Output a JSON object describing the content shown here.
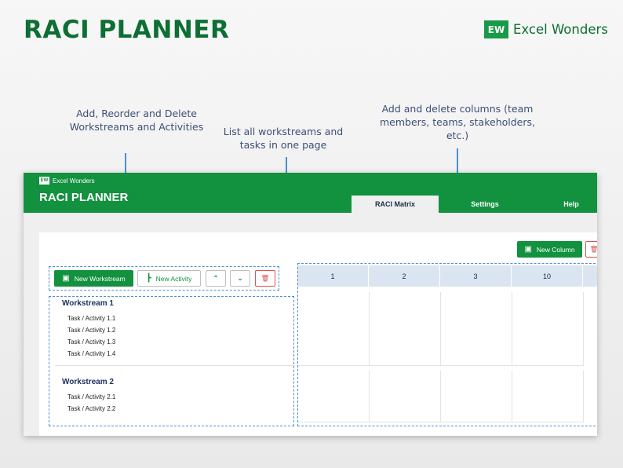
{
  "title": "RACI PLANNER",
  "brand": {
    "logo": "EW",
    "name": "Excel Wonders"
  },
  "callouts": [
    "Add, Reorder and Delete Workstreams and Activities",
    "List all workstreams and tasks in one page",
    "Add and delete columns (team members, teams, stakeholders, etc.)"
  ],
  "app": {
    "brand_logo": "EW",
    "brand_name": "Excel Wonders",
    "title": "RACI PLANNER",
    "tabs": [
      "RACI Matrix",
      "Settings",
      "Help"
    ],
    "toolbar": {
      "new_workstream": "New Workstream",
      "new_activity": "New Activity",
      "move_up_icon": "double-chevron-up-icon",
      "move_down_icon": "double-chevron-down-icon",
      "delete_icon": "trash-icon",
      "new_column": "New Column"
    },
    "columns": [
      "1",
      "2",
      "3",
      "10"
    ],
    "workstreams": [
      {
        "name": "Workstream 1",
        "tasks": [
          "Task / Activity 1.1",
          "Task / Activity 1.2",
          "Task / Activity 1.3",
          "Task / Activity 1.4"
        ]
      },
      {
        "name": "Workstream 2",
        "tasks": [
          "Task / Activity 2.1",
          "Task / Activity 2.2"
        ]
      }
    ]
  },
  "colors": {
    "brand_green": "#12913f",
    "title_green": "#0e6e34",
    "callout_blue": "#4d8fd0",
    "header_blue": "#dbe5f1"
  }
}
